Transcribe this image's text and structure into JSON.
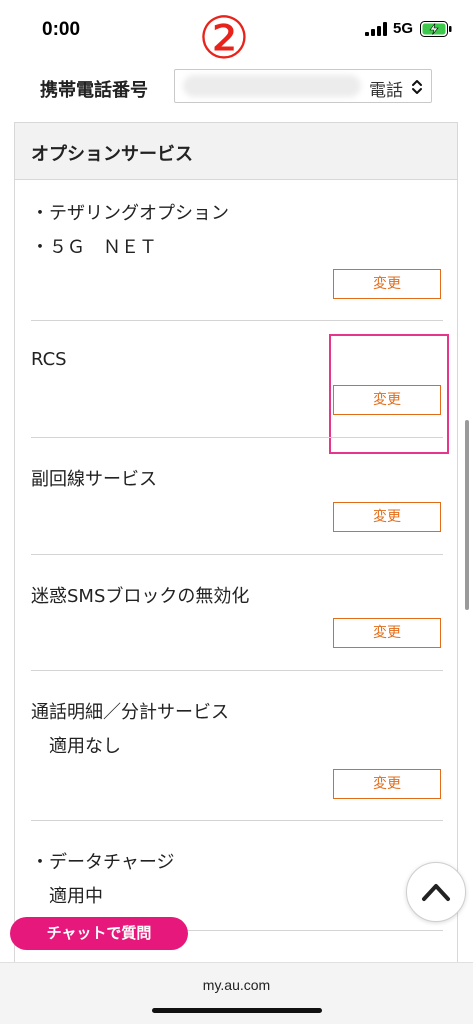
{
  "status_bar": {
    "time": "0:00",
    "network": "5G"
  },
  "annotation": {
    "number": "②"
  },
  "phone_select": {
    "label": "携帯電話番号",
    "value": "電話"
  },
  "section": {
    "title": "オプションサービス"
  },
  "options": [
    {
      "lines": [
        "・テザリングオプション",
        "・５Ｇ　ＮＥＴ"
      ],
      "button": "変更"
    },
    {
      "lines": [
        "RCS"
      ],
      "button": "変更"
    },
    {
      "lines": [
        "副回線サービス"
      ],
      "button": "変更"
    },
    {
      "lines": [
        "迷惑SMSブロックの無効化"
      ],
      "button": "変更"
    },
    {
      "lines": [
        "通話明細／分計サービス",
        "適用なし"
      ],
      "button": "変更"
    },
    {
      "lines": [
        "・データチャージ",
        "適用中"
      ]
    }
  ],
  "chat_button": {
    "label": "チャットで質問"
  },
  "browser": {
    "url": "my.au.com"
  },
  "colors": {
    "accent_orange": "#e16d1b",
    "highlight_pink": "#e5358c",
    "chat_pink": "#e6187c",
    "annotation_red": "#e8231b"
  },
  "icons": {
    "signal": "signal-icon",
    "battery": "battery-charging-icon",
    "select_arrows": "chevron-updown-icon",
    "scroll_top": "chevron-up-icon"
  }
}
